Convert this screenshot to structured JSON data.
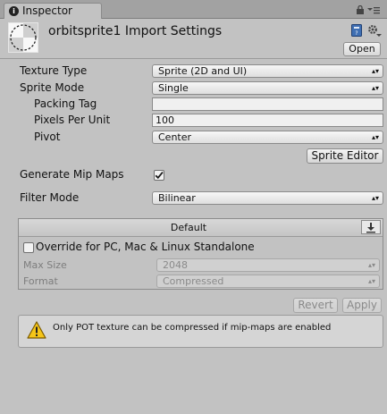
{
  "tab": {
    "title": "Inspector"
  },
  "header": {
    "title": "orbitsprite1 Import Settings",
    "open_label": "Open"
  },
  "settings": {
    "texture_type": {
      "label": "Texture Type",
      "value": "Sprite (2D and UI)"
    },
    "sprite_mode": {
      "label": "Sprite Mode",
      "value": "Single"
    },
    "packing_tag": {
      "label": "Packing Tag",
      "value": ""
    },
    "pixels_per_unit": {
      "label": "Pixels Per Unit",
      "value": "100"
    },
    "pivot": {
      "label": "Pivot",
      "value": "Center"
    },
    "sprite_editor_label": "Sprite Editor",
    "generate_mip_maps": {
      "label": "Generate Mip Maps",
      "checked": true
    },
    "filter_mode": {
      "label": "Filter Mode",
      "value": "Bilinear"
    }
  },
  "platform": {
    "header": "Default",
    "override_label": "Override for PC, Mac & Linux Standalone",
    "override_checked": false,
    "max_size": {
      "label": "Max Size",
      "value": "2048"
    },
    "format": {
      "label": "Format",
      "value": "Compressed"
    }
  },
  "actions": {
    "revert": "Revert",
    "apply": "Apply"
  },
  "help": {
    "message": "Only POT texture can be compressed if mip-maps are enabled"
  },
  "icons": {
    "tab": "info-icon",
    "lock": "lock-icon",
    "menu": "menu-icon",
    "book": "book-icon",
    "gear": "gear-icon",
    "download": "download-icon",
    "warning": "warning-icon"
  }
}
